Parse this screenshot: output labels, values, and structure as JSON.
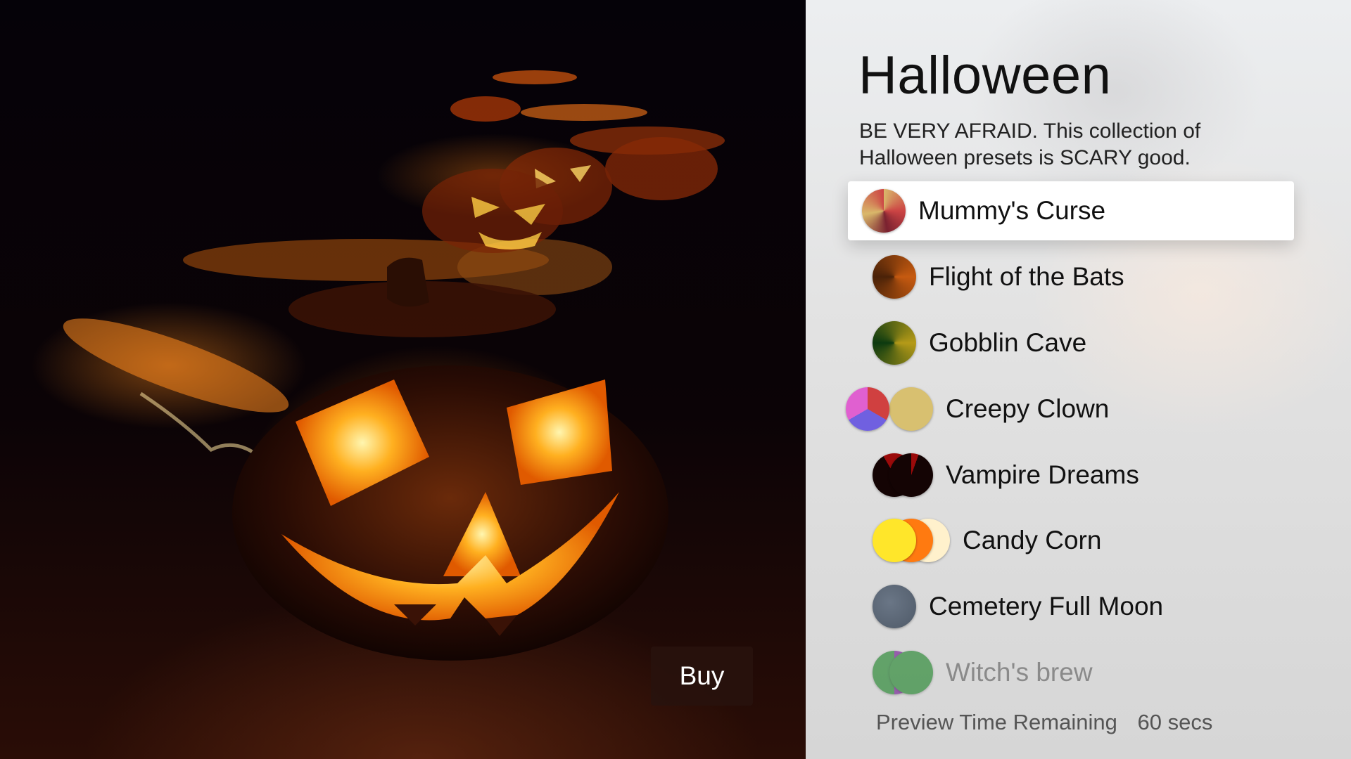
{
  "window": {
    "title": "Halloween"
  },
  "collection": {
    "title": "Halloween",
    "description": "BE VERY AFRAID. This collection of Halloween presets is SCARY good."
  },
  "buy": {
    "label": "Buy"
  },
  "presets": [
    {
      "label": "Mummy's Curse",
      "selected": true,
      "swatch_icon": "conic-gradient-circle",
      "colors": [
        "#c44",
        "#d9b86a",
        "#7a2230"
      ]
    },
    {
      "label": "Flight of the Bats",
      "selected": false,
      "swatch_icon": "brown-orange-circle",
      "colors": [
        "#4a2208",
        "#c65a10"
      ]
    },
    {
      "label": "Gobblin Cave",
      "selected": false,
      "swatch_icon": "green-gold-circle",
      "colors": [
        "#0c3a10",
        "#b59a18"
      ]
    },
    {
      "label": "Creepy Clown",
      "selected": false,
      "swatch_icon": "pink-blue-red-circles",
      "colors": [
        "#e060d0",
        "#7060e0",
        "#d04040",
        "#d8c070"
      ]
    },
    {
      "label": "Vampire Dreams",
      "selected": false,
      "swatch_icon": "black-red-circles",
      "colors": [
        "#140404",
        "#9a0a0a"
      ]
    },
    {
      "label": "Candy Corn",
      "selected": false,
      "swatch_icon": "yellow-orange-cream-circles",
      "colors": [
        "#ffe62a",
        "#ff7a10",
        "#fff1cc"
      ]
    },
    {
      "label": "Cemetery Full Moon",
      "selected": false,
      "swatch_icon": "slate-circle",
      "colors": [
        "#4f5a68"
      ]
    },
    {
      "label": "Witch's brew",
      "selected": false,
      "faded": true,
      "swatch_icon": "purple-green-circles",
      "colors": [
        "#7a2a9a",
        "#2f8a3a"
      ]
    }
  ],
  "preview": {
    "label": "Preview Time Remaining",
    "value": "60 secs"
  }
}
